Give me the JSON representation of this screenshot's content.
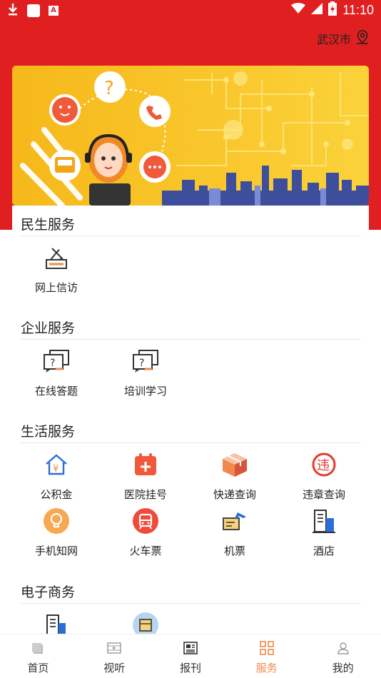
{
  "status_bar": {
    "time": "11:10"
  },
  "header": {
    "city": "武汉市"
  },
  "sections": [
    {
      "title": "民生服务",
      "items": [
        {
          "label": "网上信访",
          "icon": "ballot-box-icon"
        }
      ]
    },
    {
      "title": "企业服务",
      "items": [
        {
          "label": "在线答题",
          "icon": "question-chat-icon"
        },
        {
          "label": "培训学习",
          "icon": "question-chat-icon"
        }
      ]
    },
    {
      "title": "生活服务",
      "items": [
        {
          "label": "公积金",
          "icon": "house-yuan-icon"
        },
        {
          "label": "医院挂号",
          "icon": "calendar-plus-icon"
        },
        {
          "label": "快递查询",
          "icon": "package-icon"
        },
        {
          "label": "违章查询",
          "icon": "violation-icon"
        },
        {
          "label": "手机知网",
          "icon": "lightbulb-icon"
        },
        {
          "label": "火车票",
          "icon": "train-icon"
        },
        {
          "label": "机票",
          "icon": "airplane-ticket-icon"
        },
        {
          "label": "酒店",
          "icon": "hotel-icon"
        }
      ]
    },
    {
      "title": "电子商务",
      "items": [
        {
          "label": "",
          "icon": "building-icon"
        },
        {
          "label": "",
          "icon": "parcel-icon"
        }
      ]
    }
  ],
  "tabbar": [
    {
      "label": "首页",
      "icon": "home-icon",
      "active": false
    },
    {
      "label": "视听",
      "icon": "video-icon",
      "active": false
    },
    {
      "label": "报刊",
      "icon": "newspaper-icon",
      "active": false
    },
    {
      "label": "服务",
      "icon": "grid-icon",
      "active": true
    },
    {
      "label": "我的",
      "icon": "user-icon",
      "active": false
    }
  ],
  "colors": {
    "brand_red": "#e02020",
    "active_orange": "#f08a4b",
    "banner_yellow": "#f9c419"
  }
}
